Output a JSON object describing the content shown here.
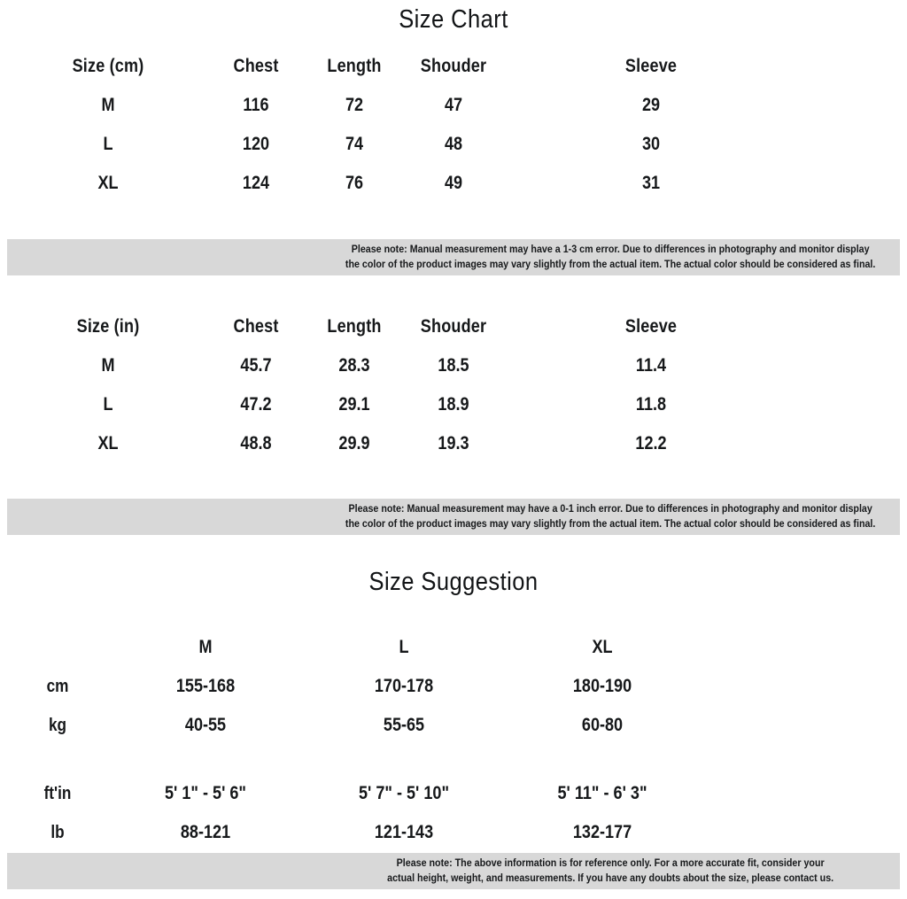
{
  "size_chart": {
    "title": "Size Chart",
    "cm_table": {
      "headers": [
        "Size (cm)",
        "Chest",
        "Length",
        "Shouder",
        "Sleeve"
      ],
      "rows": [
        {
          "size": "M",
          "chest": "116",
          "length": "72",
          "shoulder": "47",
          "sleeve": "29"
        },
        {
          "size": "L",
          "chest": "120",
          "length": "74",
          "shoulder": "48",
          "sleeve": "30"
        },
        {
          "size": "XL",
          "chest": "124",
          "length": "76",
          "shoulder": "49",
          "sleeve": "31"
        }
      ]
    },
    "cm_note": {
      "line1": "Please note: Manual measurement may have a 1-3 cm error. Due to differences in photography and monitor display",
      "line2": "the color of the product images may vary slightly from the actual item. The actual color should be considered as final."
    },
    "in_table": {
      "headers": [
        "Size (in)",
        "Chest",
        "Length",
        "Shouder",
        "Sleeve"
      ],
      "rows": [
        {
          "size": "M",
          "chest": "45.7",
          "length": "28.3",
          "shoulder": "18.5",
          "sleeve": "11.4"
        },
        {
          "size": "L",
          "chest": "47.2",
          "length": "29.1",
          "shoulder": "18.9",
          "sleeve": "11.8"
        },
        {
          "size": "XL",
          "chest": "48.8",
          "length": "29.9",
          "shoulder": "19.3",
          "sleeve": "12.2"
        }
      ]
    },
    "in_note": {
      "line1": "Please note: Manual measurement may have a 0-1 inch error. Due to differences in photography and monitor display",
      "line2": "the color of the product images may vary slightly from the actual item. The actual color should be considered as final."
    }
  },
  "size_suggestion": {
    "title": "Size Suggestion",
    "columns": [
      "M",
      "L",
      "XL"
    ],
    "rows": [
      {
        "label": "cm",
        "m": "155-168",
        "l": "170-178",
        "xl": "180-190"
      },
      {
        "label": "kg",
        "m": "40-55",
        "l": "55-65",
        "xl": "60-80"
      },
      {
        "label": "ft'in",
        "m": "5' 1\" - 5' 6\"",
        "l": "5' 7\" - 5' 10\"",
        "xl": "5' 11\" - 6' 3\""
      },
      {
        "label": "lb",
        "m": "88-121",
        "l": "121-143",
        "xl": "132-177"
      }
    ],
    "note": {
      "line1": "Please note: The above information is for reference only. For a more accurate fit, consider your",
      "line2": "actual height, weight, and measurements. If you have any doubts about the size, please contact us."
    }
  },
  "colors": {
    "background": "#ffffff",
    "text": "#16181a",
    "note_band": "#d8d8d8"
  }
}
